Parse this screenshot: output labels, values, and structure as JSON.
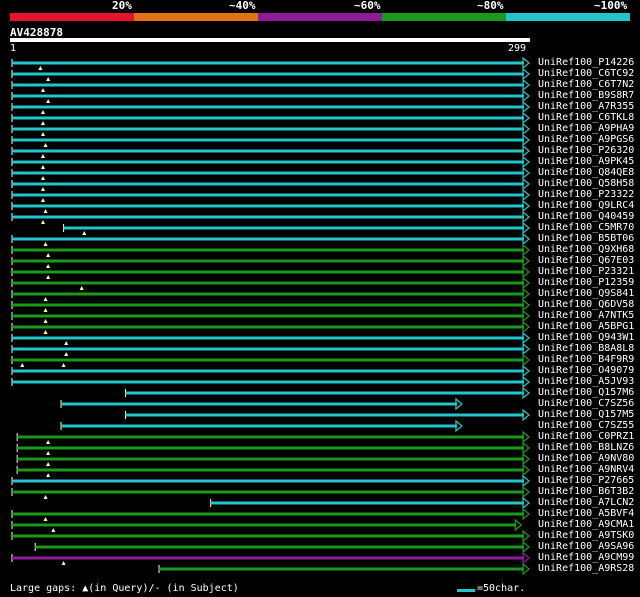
{
  "legend": {
    "labels": [
      "20%",
      "~40%",
      "~60%",
      "~80%",
      "~100%"
    ],
    "colors": [
      "#e8132e",
      "#e57117",
      "#8e1c99",
      "#1a9a1a",
      "#22c5c8"
    ]
  },
  "query": {
    "id": "AV428878",
    "start": "1",
    "end": "299"
  },
  "hits": [
    {
      "label": "UniRef100_P14226",
      "color": "#22c5c8",
      "start": 0.0,
      "end": 1.0,
      "marks": [
        0.055
      ]
    },
    {
      "label": "UniRef100_C6TC92",
      "color": "#22c5c8",
      "start": 0.0,
      "end": 1.0,
      "marks": [
        0.07
      ]
    },
    {
      "label": "UniRef100_C6T7N2",
      "color": "#22c5c8",
      "start": 0.0,
      "end": 1.0,
      "marks": [
        0.06
      ]
    },
    {
      "label": "UniRef100_B9S8R7",
      "color": "#22c5c8",
      "start": 0.0,
      "end": 1.0,
      "marks": [
        0.07
      ]
    },
    {
      "label": "UniRef100_A7R355",
      "color": "#22c5c8",
      "start": 0.0,
      "end": 1.0,
      "marks": [
        0.06
      ]
    },
    {
      "label": "UniRef100_C6TKL8",
      "color": "#22c5c8",
      "start": 0.0,
      "end": 1.0,
      "marks": [
        0.06
      ]
    },
    {
      "label": "UniRef100_A9PHA9",
      "color": "#22c5c8",
      "start": 0.0,
      "end": 1.0,
      "marks": [
        0.06
      ]
    },
    {
      "label": "UniRef100_A9PGS6",
      "color": "#22c5c8",
      "start": 0.0,
      "end": 1.0,
      "marks": [
        0.065
      ]
    },
    {
      "label": "UniRef100_P26320",
      "color": "#22c5c8",
      "start": 0.0,
      "end": 1.0,
      "marks": [
        0.06
      ]
    },
    {
      "label": "UniRef100_A9PK45",
      "color": "#22c5c8",
      "start": 0.0,
      "end": 1.0,
      "marks": [
        0.06
      ]
    },
    {
      "label": "UniRef100_Q84QE8",
      "color": "#22c5c8",
      "start": 0.0,
      "end": 1.0,
      "marks": [
        0.06
      ]
    },
    {
      "label": "UniRef100_Q58H58",
      "color": "#22c5c8",
      "start": 0.0,
      "end": 1.0,
      "marks": [
        0.06
      ]
    },
    {
      "label": "UniRef100_P23322",
      "color": "#22c5c8",
      "start": 0.0,
      "end": 1.0,
      "marks": [
        0.06
      ]
    },
    {
      "label": "UniRef100_Q9LRC4",
      "color": "#22c5c8",
      "start": 0.0,
      "end": 1.0,
      "marks": [
        0.065
      ]
    },
    {
      "label": "UniRef100_Q40459",
      "color": "#22c5c8",
      "start": 0.0,
      "end": 1.0,
      "marks": [
        0.06
      ]
    },
    {
      "label": "UniRef100_C5MR70",
      "color": "#22c5c8",
      "start": 0.1,
      "end": 1.0,
      "marks": [
        0.14
      ]
    },
    {
      "label": "UniRef100_B5BT06",
      "color": "#22c5c8",
      "start": 0.0,
      "end": 1.0,
      "marks": [
        0.065
      ]
    },
    {
      "label": "UniRef100_Q9XH68",
      "color": "#1a9a1a",
      "start": 0.0,
      "end": 1.0,
      "marks": [
        0.07
      ]
    },
    {
      "label": "UniRef100_Q67E03",
      "color": "#1a9a1a",
      "start": 0.0,
      "end": 1.0,
      "marks": [
        0.07
      ]
    },
    {
      "label": "UniRef100_P23321",
      "color": "#1a9a1a",
      "start": 0.0,
      "end": 1.0,
      "marks": [
        0.07
      ]
    },
    {
      "label": "UniRef100_P12359",
      "color": "#1a9a1a",
      "start": 0.0,
      "end": 1.0,
      "marks": [
        0.135
      ]
    },
    {
      "label": "UniRef100_Q9S841",
      "color": "#1a9a1a",
      "start": 0.0,
      "end": 1.0,
      "marks": [
        0.065
      ]
    },
    {
      "label": "UniRef100_Q6DV58",
      "color": "#1a9a1a",
      "start": 0.0,
      "end": 1.0,
      "marks": [
        0.065
      ]
    },
    {
      "label": "UniRef100_A7NTK5",
      "color": "#1a9a1a",
      "start": 0.0,
      "end": 1.0,
      "marks": [
        0.065
      ]
    },
    {
      "label": "UniRef100_A5BPG1",
      "color": "#1a9a1a",
      "start": 0.0,
      "end": 1.0,
      "marks": [
        0.065
      ]
    },
    {
      "label": "UniRef100_Q943W1",
      "color": "#22c5c8",
      "start": 0.0,
      "end": 1.0,
      "marks": [
        0.105
      ]
    },
    {
      "label": "UniRef100_B8A8L8",
      "color": "#22c5c8",
      "start": 0.0,
      "end": 1.0,
      "marks": [
        0.105
      ]
    },
    {
      "label": "UniRef100_B4F9R9",
      "color": "#1a9a1a",
      "start": 0.0,
      "end": 1.0,
      "marks": [
        0.02,
        0.1
      ]
    },
    {
      "label": "UniRef100_O49079",
      "color": "#22c5c8",
      "start": 0.0,
      "end": 1.0,
      "marks": []
    },
    {
      "label": "UniRef100_A5JV93",
      "color": "#22c5c8",
      "start": 0.0,
      "end": 1.0,
      "marks": []
    },
    {
      "label": "UniRef100_Q157M6",
      "color": "#22c5c8",
      "start": 0.22,
      "end": 1.0,
      "marks": []
    },
    {
      "label": "UniRef100_C7SZ56",
      "color": "#22c5c8",
      "start": 0.095,
      "end": 0.87,
      "marks": []
    },
    {
      "label": "UniRef100_Q157M5",
      "color": "#22c5c8",
      "start": 0.22,
      "end": 1.0,
      "marks": []
    },
    {
      "label": "UniRef100_C7SZ55",
      "color": "#22c5c8",
      "start": 0.095,
      "end": 0.87,
      "marks": []
    },
    {
      "label": "UniRef100_C0PRZ1",
      "color": "#1a9a1a",
      "start": 0.01,
      "end": 1.0,
      "marks": [
        0.07
      ]
    },
    {
      "label": "UniRef100_B8LNZ6",
      "color": "#1a9a1a",
      "start": 0.01,
      "end": 1.0,
      "marks": [
        0.07
      ]
    },
    {
      "label": "UniRef100_A9NV80",
      "color": "#1a9a1a",
      "start": 0.01,
      "end": 1.0,
      "marks": [
        0.07
      ]
    },
    {
      "label": "UniRef100_A9NRV4",
      "color": "#1a9a1a",
      "start": 0.01,
      "end": 1.0,
      "marks": [
        0.07
      ]
    },
    {
      "label": "UniRef100_P27665",
      "color": "#22c5c8",
      "start": 0.0,
      "end": 1.0,
      "marks": []
    },
    {
      "label": "UniRef100_B6T3B2",
      "color": "#1a9a1a",
      "start": 0.0,
      "end": 1.0,
      "marks": [
        0.065
      ]
    },
    {
      "label": "UniRef100_A7LCN2",
      "color": "#22c5c8",
      "start": 0.385,
      "end": 1.0,
      "marks": []
    },
    {
      "label": "UniRef100_A5BVF4",
      "color": "#1a9a1a",
      "start": 0.0,
      "end": 1.0,
      "marks": [
        0.065
      ]
    },
    {
      "label": "UniRef100_A9CMA1",
      "color": "#1a9a1a",
      "start": 0.0,
      "end": 0.985,
      "marks": [
        0.08
      ]
    },
    {
      "label": "UniRef100_A9TSK0",
      "color": "#1a9a1a",
      "start": 0.0,
      "end": 1.0,
      "marks": []
    },
    {
      "label": "UniRef100_A9SA96",
      "color": "#1a9a1a",
      "start": 0.045,
      "end": 1.0,
      "marks": []
    },
    {
      "label": "UniRef100_A9CM99",
      "color": "#8e1c99",
      "start": 0.0,
      "end": 1.0,
      "marks": [
        0.1
      ]
    },
    {
      "label": "UniRef100_A9RS28",
      "color": "#1a9a1a",
      "start": 0.285,
      "end": 1.0,
      "marks": []
    }
  ],
  "footer": {
    "text": "Large gaps: ▲(in Query)/- (in Subject)",
    "scale_text": "=50char."
  }
}
